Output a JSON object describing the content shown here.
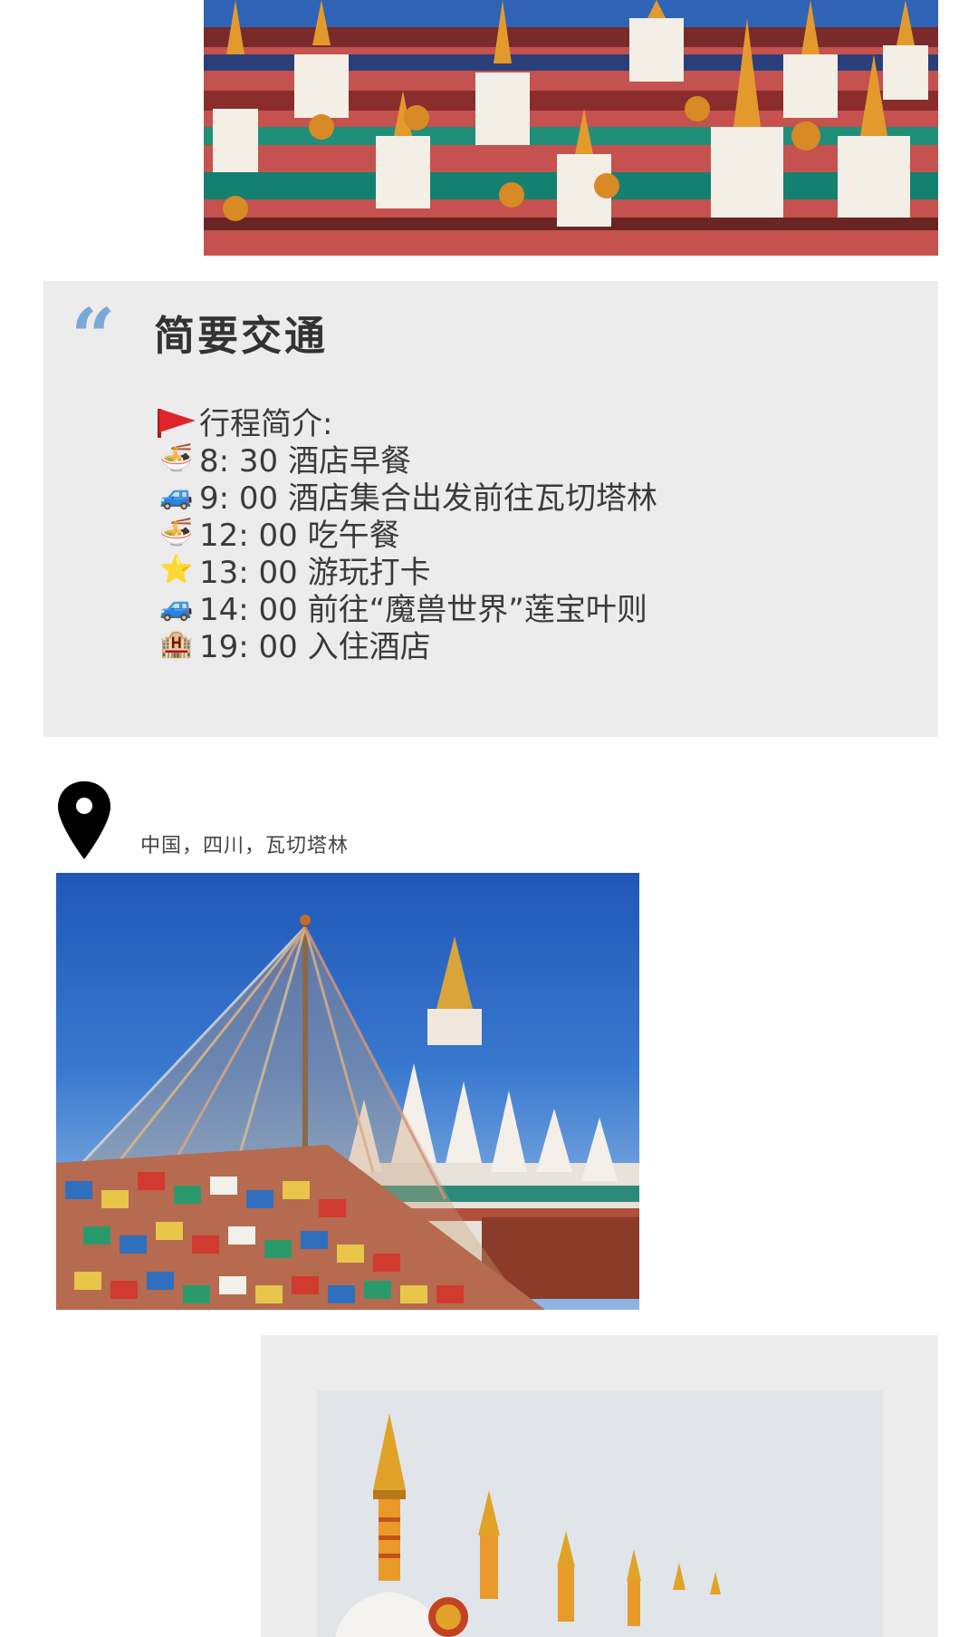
{
  "colors": {
    "card_background": "#ececec",
    "quote_mark": "#7aa8d8",
    "title_text": "#333333",
    "body_text": "#3a3a3a"
  },
  "transport_card": {
    "quote_icon": "quote-icon",
    "title": "简要交通",
    "itinerary_heading": "行程简介:",
    "schedule": [
      {
        "icon": "noodle-bowl-icon",
        "emoji": "🍜",
        "text": "8:  30 酒店早餐"
      },
      {
        "icon": "car-icon",
        "emoji": "🚙",
        "text": "9:  00 酒店集合出发前往瓦切塔林"
      },
      {
        "icon": "noodle-bowl-icon",
        "emoji": "🍜",
        "text": "12:  00 吃午餐"
      },
      {
        "icon": "star-icon",
        "emoji": "⭐",
        "text": "13:  00 游玩打卡"
      },
      {
        "icon": "car-icon",
        "emoji": "🚙",
        "text": "14:  00 前往“魔兽世界”莲宝叶则"
      },
      {
        "icon": "hotel-icon",
        "emoji": "🏨",
        "text": "19:  00 入住酒店"
      }
    ]
  },
  "location": {
    "icon": "map-pin-icon",
    "text": "中国，四川，瓦切塔林"
  },
  "images": {
    "top": "stupa-photo",
    "middle": "prayer-flags-photo",
    "bottom": "golden-spire-stupa-photo"
  }
}
